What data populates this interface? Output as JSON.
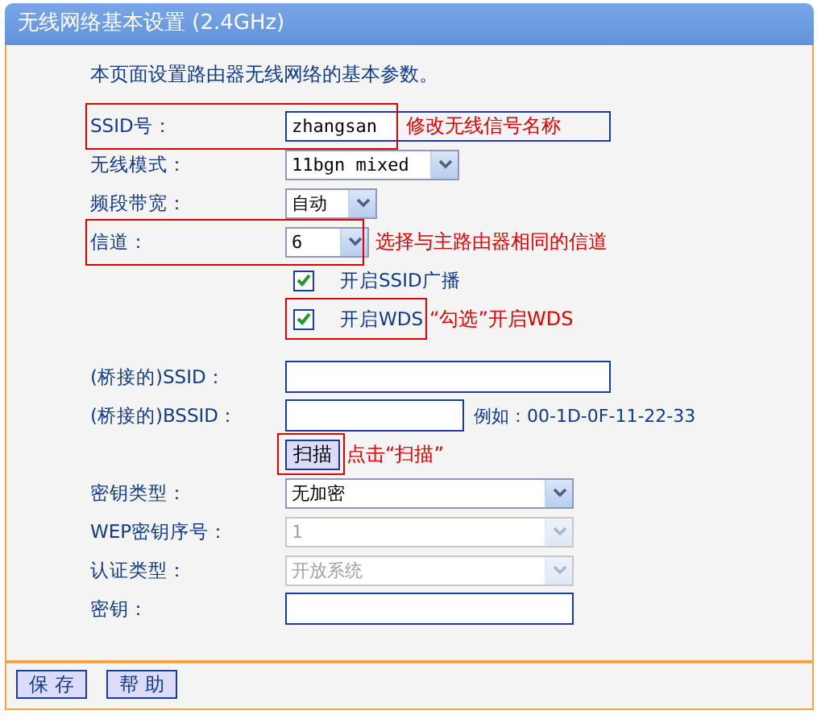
{
  "window": {
    "title": "无线网络基本设置 (2.4GHz)"
  },
  "intro": "本页面设置路由器无线网络的基本参数。",
  "wireless": [
    {
      "kind": "text",
      "label": "SSID号：",
      "value": "zhangsan",
      "highlighted": true,
      "framed": true,
      "note": "修改无线信号名称"
    },
    {
      "kind": "select",
      "label": "无线模式：",
      "value": "11bgn mixed"
    },
    {
      "kind": "select",
      "label": "频段带宽：",
      "value": "自动"
    },
    {
      "kind": "select",
      "label": "信道：",
      "value": "6",
      "highlighted": true,
      "note": "选择与主路由器相同的信道"
    },
    {
      "kind": "checkbox",
      "label": "开启SSID广播",
      "checked": true
    },
    {
      "kind": "checkbox",
      "label": "开启WDS",
      "checked": true,
      "highlighted": true,
      "note": "“勾选”开启WDS"
    }
  ],
  "bridge": [
    {
      "kind": "text",
      "label": "(桥接的)SSID："
    },
    {
      "kind": "text",
      "label": "(桥接的)BSSID：",
      "hint": "例如：00-1D-0F-11-22-33"
    },
    {
      "kind": "button",
      "label": "扫描",
      "highlighted": true,
      "note": "点击“扫描”"
    },
    {
      "kind": "select",
      "label": "密钥类型：",
      "value": "无加密"
    },
    {
      "kind": "select",
      "label": "WEP密钥序号：",
      "value": "1",
      "disabled": true
    },
    {
      "kind": "select",
      "label": "认证类型：",
      "value": "开放系统",
      "disabled": true
    },
    {
      "kind": "text",
      "label": "密钥："
    }
  ],
  "buttons": [
    "保 存",
    "帮 助"
  ]
}
